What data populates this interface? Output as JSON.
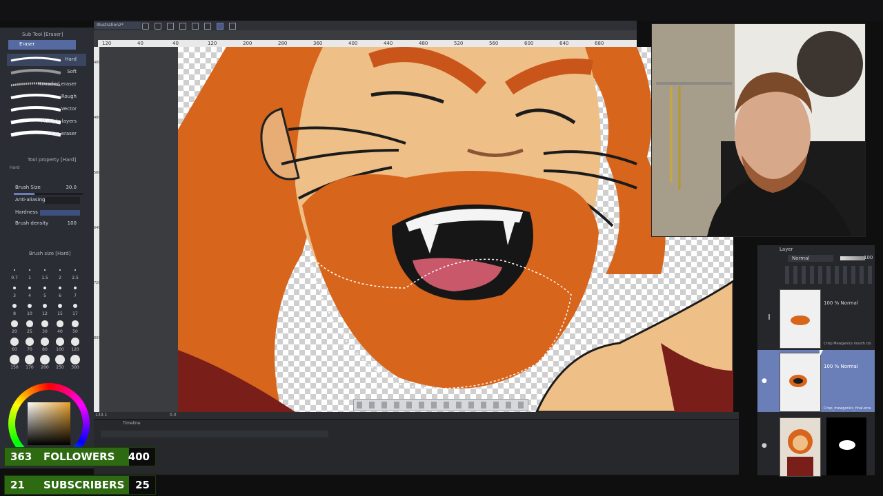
{
  "app": {
    "document_tab": "Illustration2*"
  },
  "left_panel": {
    "sub_tool_tab": "Sub Tool [Eraser]",
    "group_label": "Eraser",
    "brushes": [
      {
        "label": "Hard"
      },
      {
        "label": "Soft"
      },
      {
        "label": "Kneaded eraser"
      },
      {
        "label": "Rough"
      },
      {
        "label": "Vector"
      },
      {
        "label": "Multiple layers"
      },
      {
        "label": "Snap eraser"
      }
    ],
    "tool_property_tab": "Tool property [Hard]",
    "tool_property_name": "Hard",
    "brush_size_label": "Brush Size",
    "brush_size_value": "30.0",
    "anti_aliasing_label": "Anti-aliasing",
    "hardness_label": "Hardness",
    "brush_density_label": "Brush density",
    "brush_density_value": "100",
    "brush_size_tab": "Brush size [Hard]",
    "size_presets": [
      "0.7",
      "1",
      "1.5",
      "2",
      "2.5",
      "3",
      "4",
      "5",
      "6",
      "7",
      "8",
      "10",
      "12",
      "15",
      "17",
      "20",
      "25",
      "30",
      "40",
      "50",
      "60",
      "70",
      "80",
      "100",
      "120",
      "150",
      "170",
      "200",
      "250",
      "300"
    ]
  },
  "rulers": {
    "horizontal": [
      "120",
      "40",
      "40",
      "120",
      "200",
      "280",
      "360",
      "400",
      "440",
      "480",
      "520",
      "560",
      "600",
      "640",
      "680"
    ],
    "vertical": [
      "400",
      "480",
      "560",
      "640",
      "720",
      "800"
    ]
  },
  "status_bar": {
    "zoom": "133.1",
    "angle": "0.0"
  },
  "timeline": {
    "tab": "Timeline"
  },
  "layer_panel": {
    "tab": "Layer",
    "blend_mode": "Normal",
    "opacity": "100",
    "layers": [
      {
        "opacity_mode": "100 % Normal",
        "name": "Crisp Mewgenics mouth clo"
      },
      {
        "opacity_mode": "100 % Normal",
        "name": "Crisp_mewgenics_final.erra"
      },
      {
        "opacity_mode": "",
        "name": ""
      }
    ]
  },
  "counters": {
    "followers": {
      "current": "363",
      "label": "FOLLOWERS",
      "goal": "400"
    },
    "subscribers": {
      "current": "21",
      "label": "SUBSCRIBERS",
      "goal": "25"
    }
  },
  "colors": {
    "accent": "#6a7fb8",
    "counter_green": "#2d6a12",
    "hair_orange": "#d8651c"
  }
}
